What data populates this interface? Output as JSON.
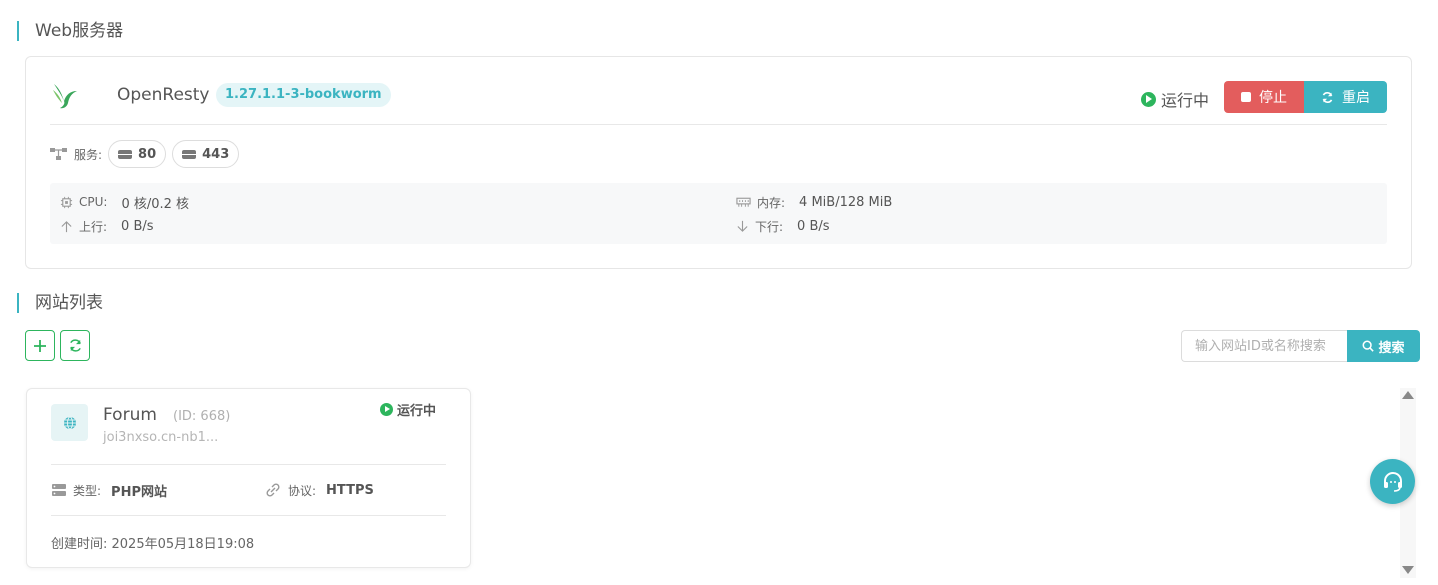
{
  "web_section": {
    "title": "Web服务器"
  },
  "server": {
    "name": "OpenResty",
    "version": "1.27.1.1-3-bookworm",
    "status": "运行中",
    "stop_label": "停止",
    "restart_label": "重启",
    "ports_label": "服务:",
    "ports": [
      "80",
      "443"
    ],
    "stats": {
      "cpu_label": "CPU:",
      "cpu_value": "0 核/0.2 核",
      "mem_label": "内存:",
      "mem_value": "4 MiB/128 MiB",
      "up_label": "上行:",
      "up_value": "0 B/s",
      "down_label": "下行:",
      "down_value": "0 B/s"
    },
    "colors": {
      "accent": "#3bb4c1",
      "stop": "#e35d5d",
      "running": "#2db55d"
    }
  },
  "sites_section": {
    "title": "网站列表"
  },
  "toolbar": {
    "search_placeholder": "输入网站ID或名称搜索",
    "search_label": "搜索"
  },
  "sites": [
    {
      "name": "Forum",
      "id": "(ID: 668)",
      "domain": "joi3nxso.cn-nb1...",
      "status": "运行中",
      "type_label": "类型:",
      "type_value": "PHP网站",
      "protocol_label": "协议:",
      "protocol_value": "HTTPS",
      "created": "创建时间: 2025年05月18日19:08"
    }
  ]
}
